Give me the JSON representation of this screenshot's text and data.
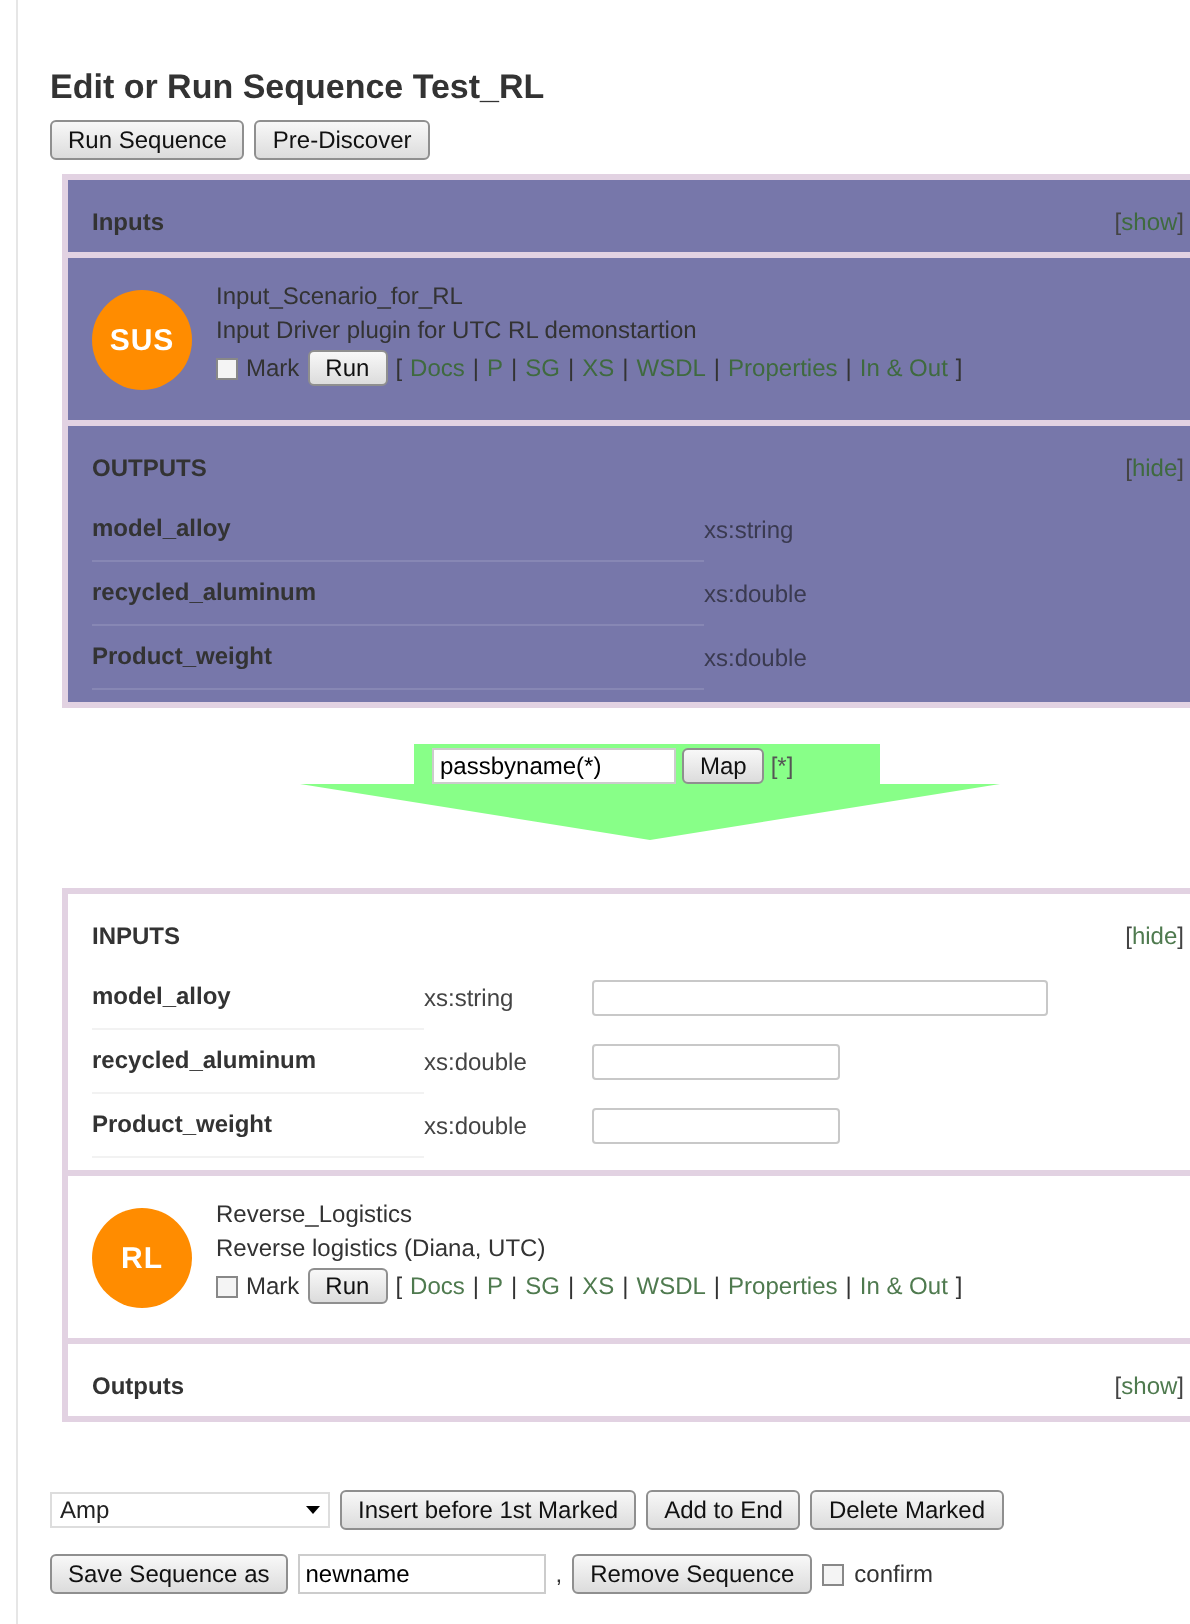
{
  "title": "Edit or Run Sequence Test_RL",
  "top_buttons": [
    "Run Sequence",
    "Pre-Discover"
  ],
  "modules": [
    {
      "selected": true,
      "badge": "SUS",
      "name": "Input_Scenario_for_RL",
      "description": "Input Driver plugin for UTC RL demonstartion",
      "mark_label": "Mark",
      "marked": false,
      "run_label": "Run",
      "links": [
        {
          "kind": "punct",
          "text": "["
        },
        {
          "kind": "link",
          "text": "Docs"
        },
        {
          "kind": "punct",
          "text": "|"
        },
        {
          "kind": "link",
          "text": "P"
        },
        {
          "kind": "punct",
          "text": "|"
        },
        {
          "kind": "link",
          "text": "SG"
        },
        {
          "kind": "punct",
          "text": "|"
        },
        {
          "kind": "link",
          "text": "XS"
        },
        {
          "kind": "punct",
          "text": "|"
        },
        {
          "kind": "link",
          "text": "WSDL"
        },
        {
          "kind": "punct",
          "text": "|"
        },
        {
          "kind": "link",
          "text": "Properties"
        },
        {
          "kind": "punct",
          "text": "|"
        },
        {
          "kind": "link",
          "text": "In & Out"
        },
        {
          "kind": "punct",
          "text": "]"
        }
      ],
      "inputs": {
        "title": "Inputs",
        "toggle": {
          "open": "[",
          "label": "show",
          "close": "]"
        }
      },
      "outputs": {
        "title": "OUTPUTS",
        "toggle": {
          "open": "[",
          "label": "hide",
          "close": "]"
        },
        "params": [
          {
            "name": "model_alloy",
            "type": "xs:string"
          },
          {
            "name": "recycled_aluminum",
            "type": "xs:double"
          },
          {
            "name": "Product_weight",
            "type": "xs:double"
          }
        ]
      }
    },
    {
      "selected": false,
      "badge": "RL",
      "name": "Reverse_Logistics",
      "description": "Reverse logistics (Diana, UTC)",
      "mark_label": "Mark",
      "marked": false,
      "run_label": "Run",
      "links": [
        {
          "kind": "punct",
          "text": "["
        },
        {
          "kind": "link",
          "text": "Docs"
        },
        {
          "kind": "punct",
          "text": "|"
        },
        {
          "kind": "link",
          "text": "P"
        },
        {
          "kind": "punct",
          "text": "|"
        },
        {
          "kind": "link",
          "text": "SG"
        },
        {
          "kind": "punct",
          "text": "|"
        },
        {
          "kind": "link",
          "text": "XS"
        },
        {
          "kind": "punct",
          "text": "|"
        },
        {
          "kind": "link",
          "text": "WSDL"
        },
        {
          "kind": "punct",
          "text": "|"
        },
        {
          "kind": "link",
          "text": "Properties"
        },
        {
          "kind": "punct",
          "text": "|"
        },
        {
          "kind": "link",
          "text": "In & Out"
        },
        {
          "kind": "punct",
          "text": "]"
        }
      ],
      "inputs": {
        "title": "INPUTS",
        "toggle": {
          "open": "[",
          "label": "hide",
          "close": "]"
        },
        "params": [
          {
            "name": "model_alloy",
            "type": "xs:string",
            "kind": "text"
          },
          {
            "name": "recycled_aluminum",
            "type": "xs:double",
            "kind": "number"
          },
          {
            "name": "Product_weight",
            "type": "xs:double",
            "kind": "number"
          }
        ]
      },
      "outputs": {
        "title": "Outputs",
        "toggle": {
          "open": "[",
          "label": "show",
          "close": "]"
        }
      }
    }
  ],
  "mapping": {
    "value": "passbyname(*)",
    "button": "Map",
    "suffix": "[*]"
  },
  "insert_row": {
    "select": "Amp",
    "buttons": [
      "Insert before 1st Marked",
      "Add to End",
      "Delete Marked"
    ]
  },
  "save_row": {
    "button": "Save Sequence as",
    "name": "newname",
    "separator": ",",
    "remove_button": "Remove Sequence",
    "confirm_label": "confirm",
    "confirm": false
  }
}
